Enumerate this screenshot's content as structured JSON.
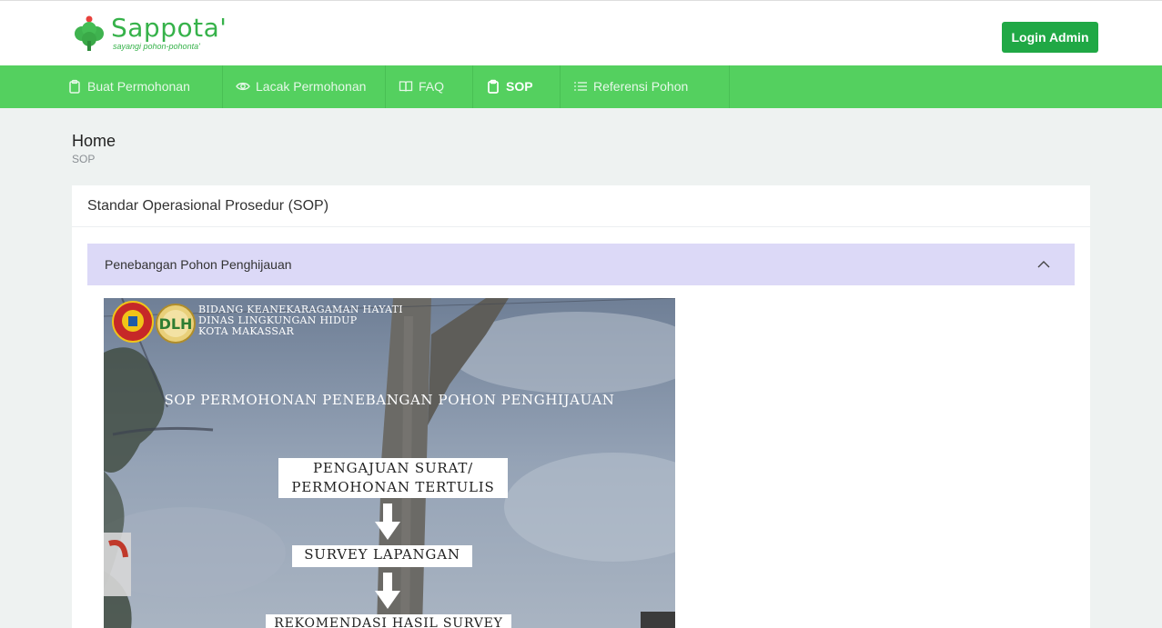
{
  "brand": {
    "name": "Sappota'",
    "tagline": "sayangi pohon-pohonta'",
    "color": "#36b24a"
  },
  "header": {
    "login_label": "Login Admin"
  },
  "nav": {
    "items": [
      {
        "label": "Buat Permohonan",
        "icon": "clipboard-icon",
        "active": false
      },
      {
        "label": "Lacak Permohonan",
        "icon": "eye-icon",
        "active": false
      },
      {
        "label": "FAQ",
        "icon": "book-icon",
        "active": false
      },
      {
        "label": "SOP",
        "icon": "clipboard-icon",
        "active": true
      },
      {
        "label": "Referensi Pohon",
        "icon": "list-icon",
        "active": false
      }
    ],
    "color": "#54d05f"
  },
  "page": {
    "title": "Home",
    "breadcrumb": "SOP"
  },
  "card": {
    "title": "Standar Operasional Prosedur (SOP)",
    "accordion": {
      "label": "Penebangan Pohon Penghijauan",
      "expanded": true,
      "color": "#dcd9f7"
    }
  },
  "sop_image": {
    "header_lines": [
      "BIDANG KEANEKARAGAMAN HAYATI",
      "DINAS LINGKUNGAN HIDUP",
      "KOTA MAKASSAR"
    ],
    "seal_text": "DLH",
    "title": "SOP PERMOHONAN PENEBANGAN POHON PENGHIJAUAN",
    "steps": [
      {
        "line1": "PENGAJUAN SURAT/",
        "line2": "PERMOHONAN TERTULIS"
      },
      {
        "line1": "SURVEY LAPANGAN"
      },
      {
        "line1": "REKOMENDASI HASIL SURVEY"
      }
    ]
  }
}
